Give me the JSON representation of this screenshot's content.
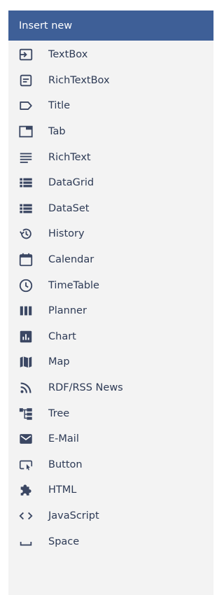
{
  "panel": {
    "title": "Insert new",
    "colors": {
      "header_bg": "#3e5f97",
      "icon": "#3b4763",
      "text": "#2d3a55"
    },
    "items": [
      {
        "label": "TextBox",
        "icon": "textbox-icon"
      },
      {
        "label": "RichTextBox",
        "icon": "richtextbox-icon"
      },
      {
        "label": "Title",
        "icon": "title-label-icon"
      },
      {
        "label": "Tab",
        "icon": "tab-icon"
      },
      {
        "label": "RichText",
        "icon": "richtext-icon"
      },
      {
        "label": "DataGrid",
        "icon": "datagrid-icon"
      },
      {
        "label": "DataSet",
        "icon": "dataset-icon"
      },
      {
        "label": "History",
        "icon": "history-icon"
      },
      {
        "label": "Calendar",
        "icon": "calendar-icon"
      },
      {
        "label": "TimeTable",
        "icon": "clock-icon"
      },
      {
        "label": "Planner",
        "icon": "planner-icon"
      },
      {
        "label": "Chart",
        "icon": "chart-icon"
      },
      {
        "label": "Map",
        "icon": "map-icon"
      },
      {
        "label": "RDF/RSS News",
        "icon": "rss-icon"
      },
      {
        "label": "Tree",
        "icon": "tree-icon"
      },
      {
        "label": "E-Mail",
        "icon": "email-icon"
      },
      {
        "label": "Button",
        "icon": "button-icon"
      },
      {
        "label": "HTML",
        "icon": "puzzle-icon"
      },
      {
        "label": "JavaScript",
        "icon": "code-icon"
      },
      {
        "label": "Space",
        "icon": "space-icon"
      }
    ]
  }
}
